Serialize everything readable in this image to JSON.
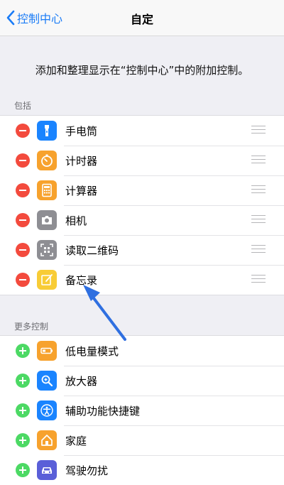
{
  "nav": {
    "back_label": "控制中心",
    "title": "自定"
  },
  "description": "添加和整理显示在“控制中心”中的附加控制。",
  "included": {
    "header": "包括",
    "items": [
      {
        "label": "手电筒",
        "icon": "flashlight-icon",
        "color": "#1a84ff"
      },
      {
        "label": "计时器",
        "icon": "timer-icon",
        "color": "#f7a22d"
      },
      {
        "label": "计算器",
        "icon": "calculator-icon",
        "color": "#f7a22d"
      },
      {
        "label": "相机",
        "icon": "camera-icon",
        "color": "#8e8e93"
      },
      {
        "label": "读取二维码",
        "icon": "qr-code-icon",
        "color": "#8e8e93"
      },
      {
        "label": "备忘录",
        "icon": "notes-icon",
        "color": "#f8cc36"
      }
    ]
  },
  "more": {
    "header": "更多控制",
    "items": [
      {
        "label": "低电量模式",
        "icon": "battery-icon",
        "color": "#f7a22d"
      },
      {
        "label": "放大器",
        "icon": "magnifier-icon",
        "color": "#1a84ff"
      },
      {
        "label": "辅助功能快捷键",
        "icon": "accessibility-icon",
        "color": "#1a84ff"
      },
      {
        "label": "家庭",
        "icon": "home-icon",
        "color": "#f7a22d"
      },
      {
        "label": "驾驶勿扰",
        "icon": "car-icon",
        "color": "#5a5fd8"
      }
    ]
  },
  "colors": {
    "accent": "#1b7cf6",
    "remove": "#f34a3d",
    "add": "#4cd964",
    "annotation_arrow": "#2f6fe0"
  }
}
